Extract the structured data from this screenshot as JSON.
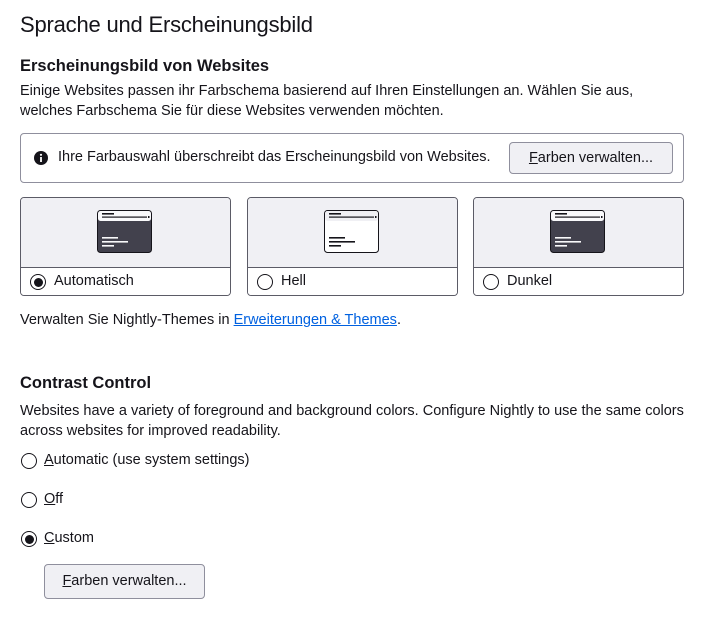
{
  "page_title": "Sprache und Erscheinungsbild",
  "website_appearance": {
    "heading": "Erscheinungsbild von Websites",
    "description": "Einige Websites passen ihr Farbschema basierend auf Ihren Einstellungen an. Wählen Sie aus, welches Farbschema Sie für diese Websites verwenden möchten.",
    "notice": {
      "text": "Ihre Farbauswahl überschreibt das Erscheinungsbild von Websites.",
      "button_accesskey": "F",
      "button_rest": "arben verwalten..."
    },
    "themes": [
      {
        "label": "Automatisch",
        "checked": true,
        "preview": "dark"
      },
      {
        "label": "Hell",
        "checked": false,
        "preview": "light"
      },
      {
        "label": "Dunkel",
        "checked": false,
        "preview": "dark"
      }
    ],
    "manage_prefix": "Verwalten Sie Nightly-Themes in ",
    "manage_link": "Erweiterungen & Themes",
    "manage_suffix": "."
  },
  "contrast_control": {
    "heading": "Contrast Control",
    "description": "Websites have a variety of foreground and background colors. Configure Nightly to use the same colors across websites for improved readability.",
    "options": [
      {
        "accesskey": "A",
        "rest": "utomatic (use system settings)",
        "checked": false
      },
      {
        "accesskey": "O",
        "rest": "ff",
        "checked": false
      },
      {
        "accesskey": "C",
        "rest": "ustom",
        "checked": true
      }
    ],
    "button_accesskey": "F",
    "button_rest": "arben verwalten..."
  },
  "colors": {
    "link": "#0061e0",
    "text": "#15141a",
    "button_bg": "#f0f0f4",
    "preview_dark": "#42414d",
    "preview_light": "#ffffff"
  }
}
